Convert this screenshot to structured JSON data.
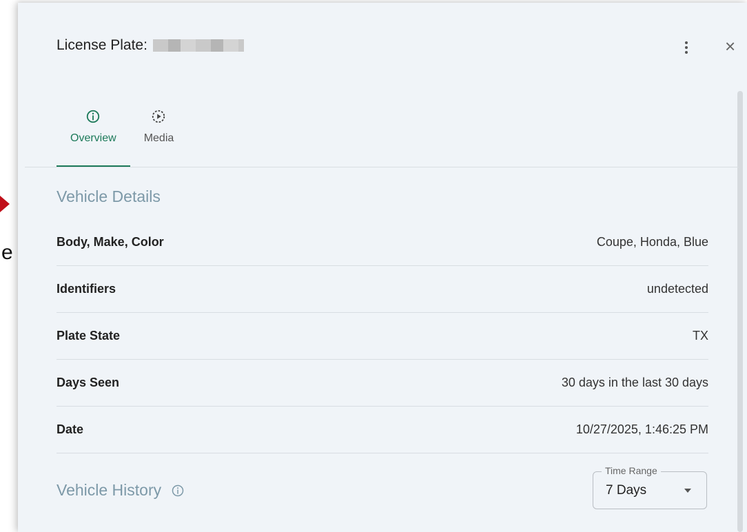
{
  "panel": {
    "title": "License Plate:",
    "more_icon": "more-vertical-icon",
    "close_icon": "close-icon",
    "close_glyph": "×"
  },
  "edge": {
    "letter": "e"
  },
  "tabs": [
    {
      "label": "Overview",
      "icon": "info-circle-icon",
      "active": true
    },
    {
      "label": "Media",
      "icon": "play-circle-icon",
      "active": false
    }
  ],
  "vehicle_details": {
    "title": "Vehicle Details",
    "rows": [
      {
        "label": "Body, Make, Color",
        "value": "Coupe, Honda, Blue"
      },
      {
        "label": "Identifiers",
        "value": "undetected"
      },
      {
        "label": "Plate State",
        "value": "TX"
      },
      {
        "label": "Days Seen",
        "value": "30 days in the last 30 days"
      },
      {
        "label": "Date",
        "value": "10/27/2025, 1:46:25 PM"
      }
    ]
  },
  "vehicle_history": {
    "title": "Vehicle History",
    "time_range": {
      "label": "Time Range",
      "value": "7 Days"
    }
  },
  "colors": {
    "accent": "#1d7a5a",
    "section_title": "#7d99a8",
    "panel_bg": "#f0f4f8"
  }
}
